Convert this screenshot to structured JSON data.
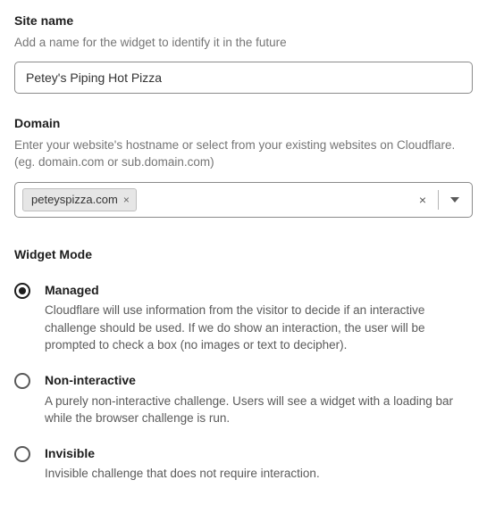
{
  "siteName": {
    "label": "Site name",
    "help": "Add a name for the widget to identify it in the future",
    "value": "Petey's Piping Hot Pizza"
  },
  "domain": {
    "label": "Domain",
    "help": "Enter your website's hostname or select from your existing websites on Cloudflare. (eg. domain.com or sub.domain.com)",
    "chip": "peteyspizza.com"
  },
  "widgetMode": {
    "title": "Widget Mode",
    "selected": "managed",
    "options": [
      {
        "id": "managed",
        "label": "Managed",
        "desc": "Cloudflare will use information from the visitor to decide if an interactive challenge should be used. If we do show an interaction, the user will be prompted to check a box (no images or text to decipher)."
      },
      {
        "id": "noninteractive",
        "label": "Non-interactive",
        "desc": "A purely non-interactive challenge. Users will see a widget with a loading bar while the browser challenge is run."
      },
      {
        "id": "invisible",
        "label": "Invisible",
        "desc": "Invisible challenge that does not require interaction."
      }
    ]
  }
}
